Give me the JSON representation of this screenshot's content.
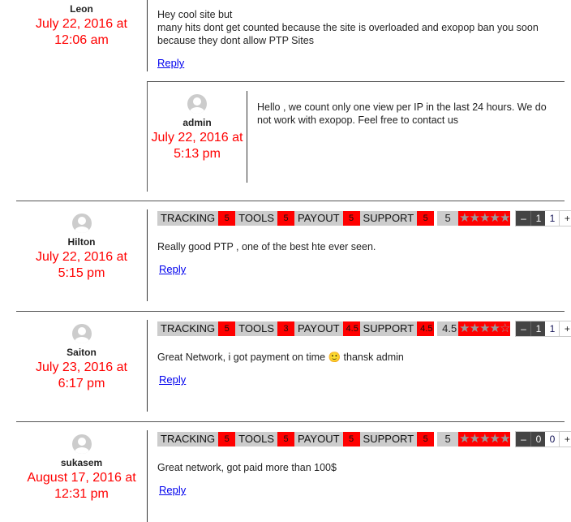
{
  "comments": [
    {
      "name": "Leon",
      "date": "July 22, 2016 at 12:06 am",
      "lines": [
        "Hey cool site but",
        "many hits dont get counted because the site is overloaded and exopop ban you soon because they dont allow PTP Sites"
      ],
      "reply": "Reply"
    },
    {
      "name": "admin",
      "date": "July 22, 2016 at 5:13 pm",
      "lines": [
        "Hello , we count only one view per IP in the last 24 hours. We do not work with exopop. Feel free to contact us"
      ]
    },
    {
      "name": "Hilton",
      "date": "July 22, 2016 at 5:15 pm",
      "ratings": {
        "tracking": "5",
        "tools": "5",
        "payout": "5",
        "support": "5",
        "average": "5",
        "stars": 5
      },
      "votes": {
        "down": "1",
        "up": "1"
      },
      "text": "Really good PTP , one of the best hte ever seen.",
      "reply": "Reply"
    },
    {
      "name": "Saiton",
      "date": "July 23, 2016 at 6:17 pm",
      "ratings": {
        "tracking": "5",
        "tools": "3",
        "payout": "4.5",
        "support": "4.5",
        "average": "4.5",
        "stars": 4.5
      },
      "votes": {
        "down": "1",
        "up": "1"
      },
      "text": "Great Network, i got payment on time 🙂 thansk admin",
      "reply": "Reply"
    },
    {
      "name": "sukasem",
      "date": "August 17, 2016 at 12:31 pm",
      "ratings": {
        "tracking": "5",
        "tools": "5",
        "payout": "5",
        "support": "5",
        "average": "5",
        "stars": 5
      },
      "votes": {
        "down": "0",
        "up": "0"
      },
      "text": "Great network, got paid more than 100$",
      "reply": "Reply"
    }
  ],
  "labels": {
    "tracking": "TRACKING",
    "tools": "TOOLS",
    "payout": "PAYOUT",
    "support": "SUPPORT",
    "minus": "–",
    "plus": "+"
  },
  "colors": {
    "date": "#ff0000",
    "rating_value": "#ff0000",
    "label_bg": "#cccccc"
  }
}
